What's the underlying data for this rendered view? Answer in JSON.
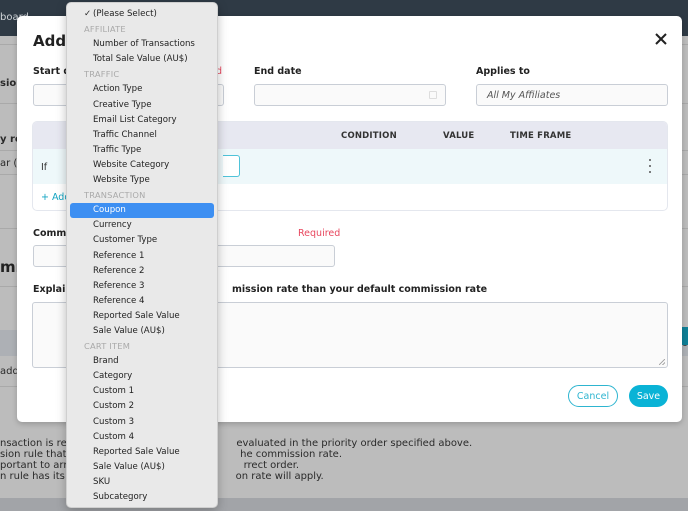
{
  "background": {
    "breadcrumb_fragment": "board",
    "left_fragments": [
      "sion",
      "y rep",
      "ar (",
      "mn",
      "adde"
    ],
    "right_fragment": "o",
    "notes": [
      "nsaction is recorded, the rules are evaluated in the priority order specified above.",
      "sion rule that has its condition met sets the commission rate.",
      "portant to arrange the rules in the correct order.",
      "n rule has its condition met, the default commission rate will apply."
    ],
    "notes_visible": [
      [
        "nsaction is reco",
        "evaluated in the priority order specified above."
      ],
      [
        "sion rule that ha",
        "he commission rate."
      ],
      [
        "portant to arra",
        "rrect order."
      ],
      [
        "n rule has its co",
        "on rate will apply."
      ]
    ]
  },
  "modal": {
    "title": "Add C",
    "close_icon": "close-icon",
    "start_date": {
      "label": "Start da",
      "value": ""
    },
    "start_required": "d",
    "end_date": {
      "label": "End date",
      "value": "",
      "icon": "calendar-icon"
    },
    "applies_to": {
      "label": "Applies to",
      "placeholder": "All My Affiliates"
    },
    "rules_table": {
      "columns": [
        "CONDITION",
        "VALUE",
        "TIME FRAME"
      ],
      "row": {
        "prefix": "If",
        "menu_icon": "kebab-icon"
      },
      "add_link": "+ Add"
    },
    "commission": {
      "label": "Commi",
      "required": "Required",
      "value": ""
    },
    "explain": {
      "label_left": "Explain",
      "label_right": "mission rate than your default commission rate",
      "value": ""
    },
    "buttons": {
      "cancel": "Cancel",
      "save": "Save"
    }
  },
  "dropdown": {
    "selected": "(Please Select)",
    "highlighted": "Coupon",
    "items": [
      {
        "type": "option",
        "label": "(Please Select)",
        "checked": true
      },
      {
        "type": "group",
        "label": "AFFILIATE"
      },
      {
        "type": "option",
        "label": "Number of Transactions"
      },
      {
        "type": "option",
        "label": "Total Sale Value (AU$)"
      },
      {
        "type": "group",
        "label": "TRAFFIC"
      },
      {
        "type": "option",
        "label": "Action Type"
      },
      {
        "type": "option",
        "label": "Creative Type"
      },
      {
        "type": "option",
        "label": "Email List Category"
      },
      {
        "type": "option",
        "label": "Traffic Channel"
      },
      {
        "type": "option",
        "label": "Traffic Type"
      },
      {
        "type": "option",
        "label": "Website Category"
      },
      {
        "type": "option",
        "label": "Website Type"
      },
      {
        "type": "group",
        "label": "TRANSACTION"
      },
      {
        "type": "option",
        "label": "Coupon",
        "highlighted": true
      },
      {
        "type": "option",
        "label": "Currency"
      },
      {
        "type": "option",
        "label": "Customer Type"
      },
      {
        "type": "option",
        "label": "Reference 1"
      },
      {
        "type": "option",
        "label": "Reference 2"
      },
      {
        "type": "option",
        "label": "Reference 3"
      },
      {
        "type": "option",
        "label": "Reference 4"
      },
      {
        "type": "option",
        "label": "Reported Sale Value"
      },
      {
        "type": "option",
        "label": "Sale Value (AU$)"
      },
      {
        "type": "group",
        "label": "CART ITEM"
      },
      {
        "type": "option",
        "label": "Brand"
      },
      {
        "type": "option",
        "label": "Category"
      },
      {
        "type": "option",
        "label": "Custom 1"
      },
      {
        "type": "option",
        "label": "Custom 2"
      },
      {
        "type": "option",
        "label": "Custom 3"
      },
      {
        "type": "option",
        "label": "Custom 4"
      },
      {
        "type": "option",
        "label": "Reported Sale Value"
      },
      {
        "type": "option",
        "label": "Sale Value (AU$)"
      },
      {
        "type": "option",
        "label": "SKU"
      },
      {
        "type": "option",
        "label": "Subcategory"
      }
    ]
  },
  "colors": {
    "accent": "#0ab3d6",
    "required": "#e8475e",
    "highlight": "#3d8ff2",
    "topbar": "#2f3a45"
  }
}
